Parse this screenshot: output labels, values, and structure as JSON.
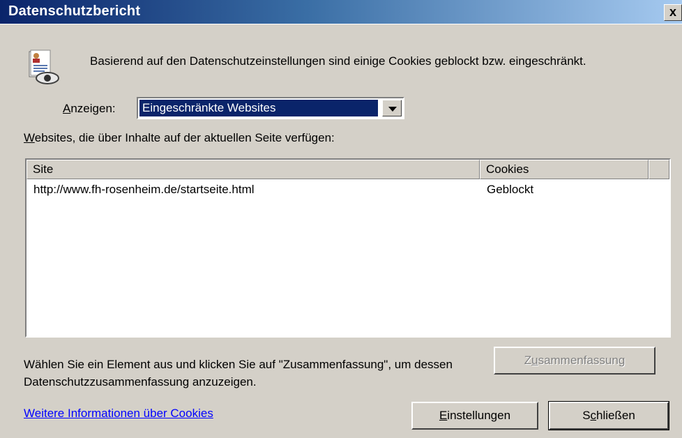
{
  "window": {
    "title": "Datenschutzbericht",
    "close_label": "x"
  },
  "intro": {
    "icon": "privacy-report-icon",
    "text": "Basierend auf den Datenschutzeinstellungen sind einige Cookies geblockt bzw. eingeschränkt."
  },
  "show": {
    "label_prefix": "",
    "label_underlined": "A",
    "label_rest": "nzeigen:",
    "selected": "Eingeschränkte Websites"
  },
  "websites": {
    "label_underlined": "W",
    "label_rest": "ebsites, die über Inhalte auf der aktuellen Seite verfügen:",
    "columns": [
      "Site",
      "Cookies"
    ],
    "rows": [
      {
        "site": "http://www.fh-rosenheim.de/startseite.html",
        "cookies": "Geblockt"
      }
    ]
  },
  "help_text": "Wählen Sie ein Element aus und klicken Sie auf \"Zusammenfassung\", um dessen Datenschutzzusammenfassung anzuzeigen.",
  "buttons": {
    "summary_pre": "Z",
    "summary_acc": "u",
    "summary_post": "sammenfassung",
    "settings_acc": "E",
    "settings_post": "instellungen",
    "close_pre": "S",
    "close_acc": "c",
    "close_post": "hließen"
  },
  "link": "Weitere Informationen über Cookies",
  "colors": {
    "title_start": "#0a246a",
    "selection": "#0a246a",
    "link": "#0000ff",
    "face": "#d4d0c8"
  }
}
